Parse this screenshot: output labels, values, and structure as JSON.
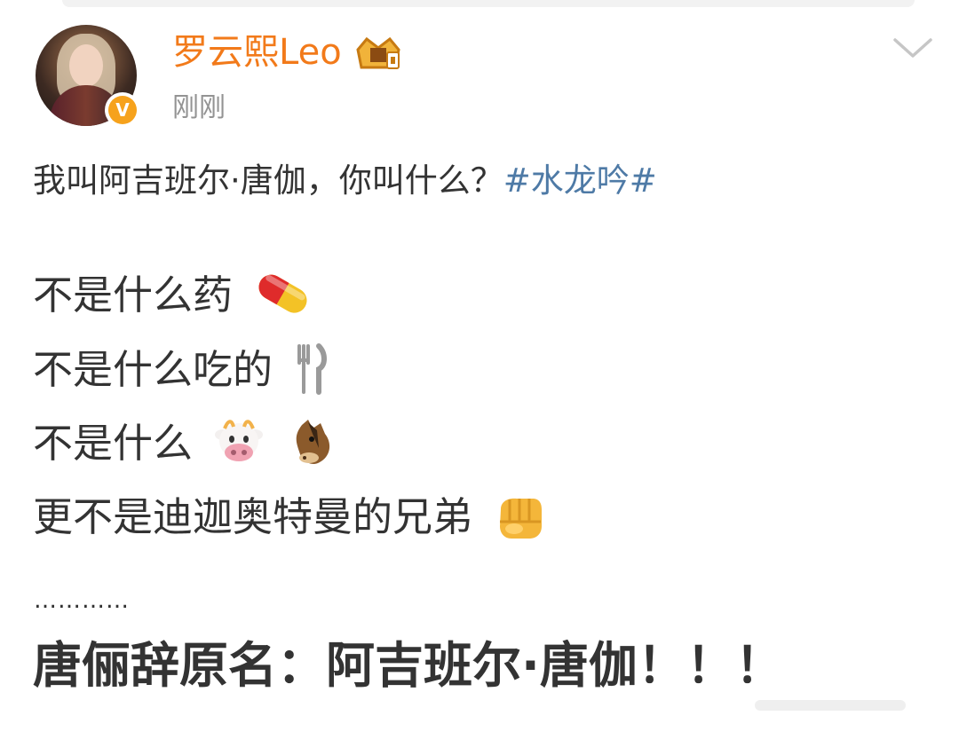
{
  "post": {
    "author": "罗云熙Leo",
    "time": "刚刚",
    "intro_text": "我叫阿吉班尔·唐伽，你叫什么？",
    "hashtag": "#水龙吟#",
    "lines": [
      "不是什么药",
      "不是什么吃的",
      "不是什么",
      "更不是迪迦奥特曼的兄弟"
    ],
    "dots": "…………",
    "final": "唐俪辞原名：阿吉班尔·唐伽！！！"
  },
  "icons": {
    "verified": "v-badge-icon",
    "crown": "crown-icon",
    "menu": "chevron-down-icon",
    "pill": "pill-icon",
    "utensils": "fork-knife-icon",
    "cow": "cow-face-icon",
    "horse": "horse-face-icon",
    "fist": "oncoming-fist-icon"
  },
  "colors": {
    "name": "#f27a1a",
    "time": "#939393",
    "hashtag": "#4e7aa6",
    "text": "#333333"
  }
}
